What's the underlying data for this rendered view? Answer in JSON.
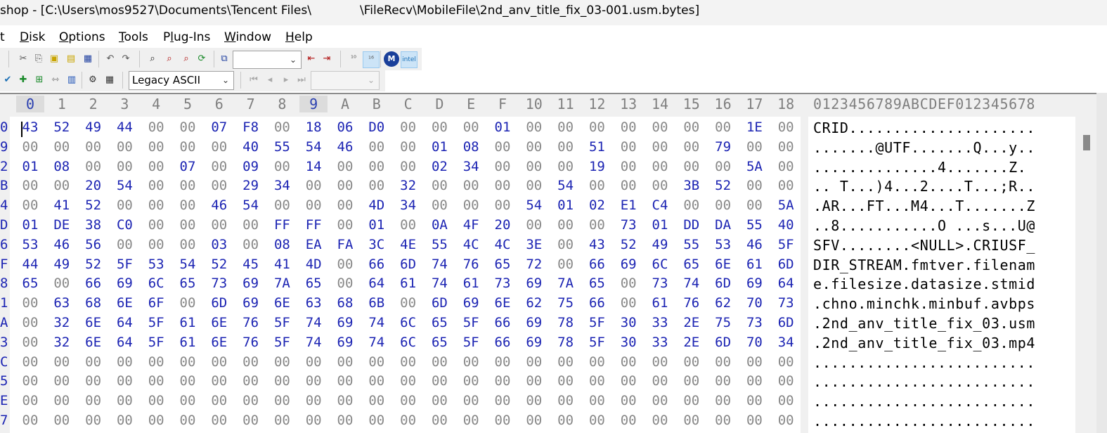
{
  "window": {
    "title_left": "shop - [C:\\Users\\mos9527\\Documents\\Tencent Files\\",
    "title_right": "\\FileRecv\\MobileFile\\2nd_anv_title_fix_03-001.usm.bytes]"
  },
  "menu": [
    "t",
    "Disk",
    "Options",
    "Tools",
    "Plug-Ins",
    "Window",
    "Help"
  ],
  "toolbar": {
    "charset": "Legacy ASCII",
    "font_select": "",
    "offset_select": ""
  },
  "columns": [
    "0",
    "1",
    "2",
    "3",
    "4",
    "5",
    "6",
    "7",
    "8",
    "9",
    "A",
    "B",
    "C",
    "D",
    "E",
    "F",
    "10",
    "11",
    "12",
    "13",
    "14",
    "15",
    "16",
    "17",
    "18"
  ],
  "ascii_header": "0123456789ABCDEF012345678",
  "rows": [
    {
      "offset": "0",
      "bytes": [
        "43",
        "52",
        "49",
        "44",
        "00",
        "00",
        "07",
        "F8",
        "00",
        "18",
        "06",
        "D0",
        "00",
        "00",
        "00",
        "01",
        "00",
        "00",
        "00",
        "00",
        "00",
        "00",
        "00",
        "1E",
        "00"
      ],
      "ascii": "CRID....................."
    },
    {
      "offset": "9",
      "bytes": [
        "00",
        "00",
        "00",
        "00",
        "00",
        "00",
        "00",
        "40",
        "55",
        "54",
        "46",
        "00",
        "00",
        "01",
        "08",
        "00",
        "00",
        "00",
        "51",
        "00",
        "00",
        "00",
        "79",
        "00",
        "00"
      ],
      "ascii": ".......@UTF.......Q...y.."
    },
    {
      "offset": "2",
      "bytes": [
        "01",
        "08",
        "00",
        "00",
        "00",
        "07",
        "00",
        "09",
        "00",
        "14",
        "00",
        "00",
        "00",
        "02",
        "34",
        "00",
        "00",
        "00",
        "19",
        "00",
        "00",
        "00",
        "00",
        "5A",
        "00"
      ],
      "ascii": "..............4.......Z."
    },
    {
      "offset": "B",
      "bytes": [
        "00",
        "00",
        "20",
        "54",
        "00",
        "00",
        "00",
        "29",
        "34",
        "00",
        "00",
        "00",
        "32",
        "00",
        "00",
        "00",
        "00",
        "54",
        "00",
        "00",
        "00",
        "3B",
        "52",
        "00",
        "00"
      ],
      "ascii": ".. T...)4...2....T...;R.."
    },
    {
      "offset": "4",
      "bytes": [
        "00",
        "41",
        "52",
        "00",
        "00",
        "00",
        "46",
        "54",
        "00",
        "00",
        "00",
        "4D",
        "34",
        "00",
        "00",
        "00",
        "54",
        "01",
        "02",
        "E1",
        "C4",
        "00",
        "00",
        "00",
        "5A"
      ],
      "ascii": ".AR...FT...M4...T.......Z"
    },
    {
      "offset": "D",
      "bytes": [
        "01",
        "DE",
        "38",
        "C0",
        "00",
        "00",
        "00",
        "00",
        "FF",
        "FF",
        "00",
        "01",
        "00",
        "0A",
        "4F",
        "20",
        "00",
        "00",
        "00",
        "73",
        "01",
        "DD",
        "DA",
        "55",
        "40"
      ],
      "ascii": "..8...........O ...s...U@"
    },
    {
      "offset": "6",
      "bytes": [
        "53",
        "46",
        "56",
        "00",
        "00",
        "00",
        "03",
        "00",
        "08",
        "EA",
        "FA",
        "3C",
        "4E",
        "55",
        "4C",
        "4C",
        "3E",
        "00",
        "43",
        "52",
        "49",
        "55",
        "53",
        "46",
        "5F"
      ],
      "ascii": "SFV........<NULL>.CRIUSF_"
    },
    {
      "offset": "F",
      "bytes": [
        "44",
        "49",
        "52",
        "5F",
        "53",
        "54",
        "52",
        "45",
        "41",
        "4D",
        "00",
        "66",
        "6D",
        "74",
        "76",
        "65",
        "72",
        "00",
        "66",
        "69",
        "6C",
        "65",
        "6E",
        "61",
        "6D"
      ],
      "ascii": "DIR_STREAM.fmtver.filenam"
    },
    {
      "offset": "8",
      "bytes": [
        "65",
        "00",
        "66",
        "69",
        "6C",
        "65",
        "73",
        "69",
        "7A",
        "65",
        "00",
        "64",
        "61",
        "74",
        "61",
        "73",
        "69",
        "7A",
        "65",
        "00",
        "73",
        "74",
        "6D",
        "69",
        "64"
      ],
      "ascii": "e.filesize.datasize.stmid"
    },
    {
      "offset": "1",
      "bytes": [
        "00",
        "63",
        "68",
        "6E",
        "6F",
        "00",
        "6D",
        "69",
        "6E",
        "63",
        "68",
        "6B",
        "00",
        "6D",
        "69",
        "6E",
        "62",
        "75",
        "66",
        "00",
        "61",
        "76",
        "62",
        "70",
        "73"
      ],
      "ascii": ".chno.minchk.minbuf.avbps"
    },
    {
      "offset": "A",
      "bytes": [
        "00",
        "32",
        "6E",
        "64",
        "5F",
        "61",
        "6E",
        "76",
        "5F",
        "74",
        "69",
        "74",
        "6C",
        "65",
        "5F",
        "66",
        "69",
        "78",
        "5F",
        "30",
        "33",
        "2E",
        "75",
        "73",
        "6D"
      ],
      "ascii": ".2nd_anv_title_fix_03.usm"
    },
    {
      "offset": "3",
      "bytes": [
        "00",
        "32",
        "6E",
        "64",
        "5F",
        "61",
        "6E",
        "76",
        "5F",
        "74",
        "69",
        "74",
        "6C",
        "65",
        "5F",
        "66",
        "69",
        "78",
        "5F",
        "30",
        "33",
        "2E",
        "6D",
        "70",
        "34"
      ],
      "ascii": ".2nd_anv_title_fix_03.mp4"
    },
    {
      "offset": "C",
      "bytes": [
        "00",
        "00",
        "00",
        "00",
        "00",
        "00",
        "00",
        "00",
        "00",
        "00",
        "00",
        "00",
        "00",
        "00",
        "00",
        "00",
        "00",
        "00",
        "00",
        "00",
        "00",
        "00",
        "00",
        "00",
        "00"
      ],
      "ascii": "........................."
    },
    {
      "offset": "5",
      "bytes": [
        "00",
        "00",
        "00",
        "00",
        "00",
        "00",
        "00",
        "00",
        "00",
        "00",
        "00",
        "00",
        "00",
        "00",
        "00",
        "00",
        "00",
        "00",
        "00",
        "00",
        "00",
        "00",
        "00",
        "00",
        "00"
      ],
      "ascii": "........................."
    },
    {
      "offset": "E",
      "bytes": [
        "00",
        "00",
        "00",
        "00",
        "00",
        "00",
        "00",
        "00",
        "00",
        "00",
        "00",
        "00",
        "00",
        "00",
        "00",
        "00",
        "00",
        "00",
        "00",
        "00",
        "00",
        "00",
        "00",
        "00",
        "00"
      ],
      "ascii": "........................."
    },
    {
      "offset": "7",
      "bytes": [
        "00",
        "00",
        "00",
        "00",
        "00",
        "00",
        "00",
        "00",
        "00",
        "00",
        "00",
        "00",
        "00",
        "00",
        "00",
        "00",
        "00",
        "00",
        "00",
        "00",
        "00",
        "00",
        "00",
        "00",
        "00"
      ],
      "ascii": "........................."
    }
  ],
  "icons": {
    "row1": [
      "cut-icon",
      "copy-icon",
      "paste-icon",
      "paste-special-icon",
      "paste-write-icon",
      "undo-icon",
      "redo-icon",
      "find-icon",
      "find-prev-icon",
      "find-next-icon",
      "replace-icon",
      "goto-offset-icon",
      "goto-prev-icon",
      "goto-next-icon",
      "hex-view-icon",
      "dec-view-icon",
      "motorola-icon",
      "intel-icon"
    ],
    "row2": [
      "check-icon",
      "add-icon",
      "compare-icon",
      "sync-icon",
      "chart-icon",
      "gear-icon",
      "calculator-icon",
      "first-icon",
      "prev-icon",
      "next-icon",
      "last-icon"
    ]
  }
}
